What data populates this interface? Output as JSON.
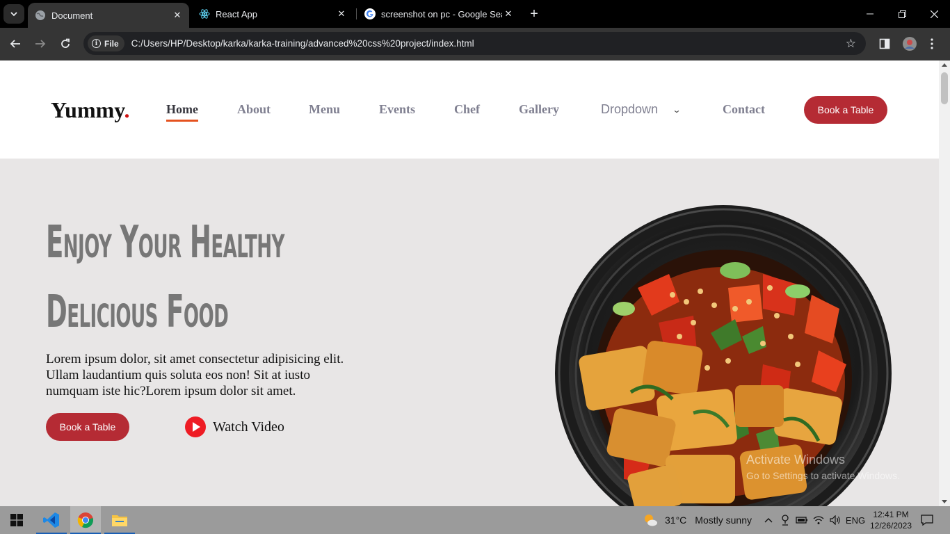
{
  "browser": {
    "tabs": [
      {
        "title": "Document",
        "active": true
      },
      {
        "title": "React App",
        "active": false
      },
      {
        "title": "screenshot on pc - Google Search",
        "active": false
      }
    ],
    "omnibox": {
      "scheme_chip": "File",
      "url": "C:/Users/HP/Desktop/karka/karka-training/advanced%20css%20project/index.html"
    }
  },
  "site": {
    "logo": "Yummy",
    "logo_dot": ".",
    "nav": {
      "home": "Home",
      "about": "About",
      "menu": "Menu",
      "events": "Events",
      "chef": "Chef",
      "gallery": "Gallery",
      "dropdown": "Dropdown",
      "contact": "Contact"
    },
    "header_cta": "Book a Table",
    "hero": {
      "title_line1": "Enjoy Your Healthy",
      "title_line2": "Delicious Food",
      "text": "Lorem ipsum dolor, sit amet consectetur adipisicing elit. Ullam laudantium quis soluta eos non! Sit at iusto numquam iste hic?Lorem ipsum dolor sit amet.",
      "cta": "Book a Table",
      "watch_video": "Watch Video"
    }
  },
  "watermark": {
    "line1": "Activate Windows",
    "line2": "Go to Settings to activate Windows."
  },
  "taskbar": {
    "weather_temp": "31°C",
    "weather_condition": "Mostly sunny",
    "language": "ENG",
    "time": "12:41 PM",
    "date": "12/26/2023"
  },
  "colors": {
    "brand_red": "#b52b34",
    "nav_active_underline": "#e5521f",
    "play_button": "#ee1c24",
    "hero_bg": "#e8e6e6"
  }
}
